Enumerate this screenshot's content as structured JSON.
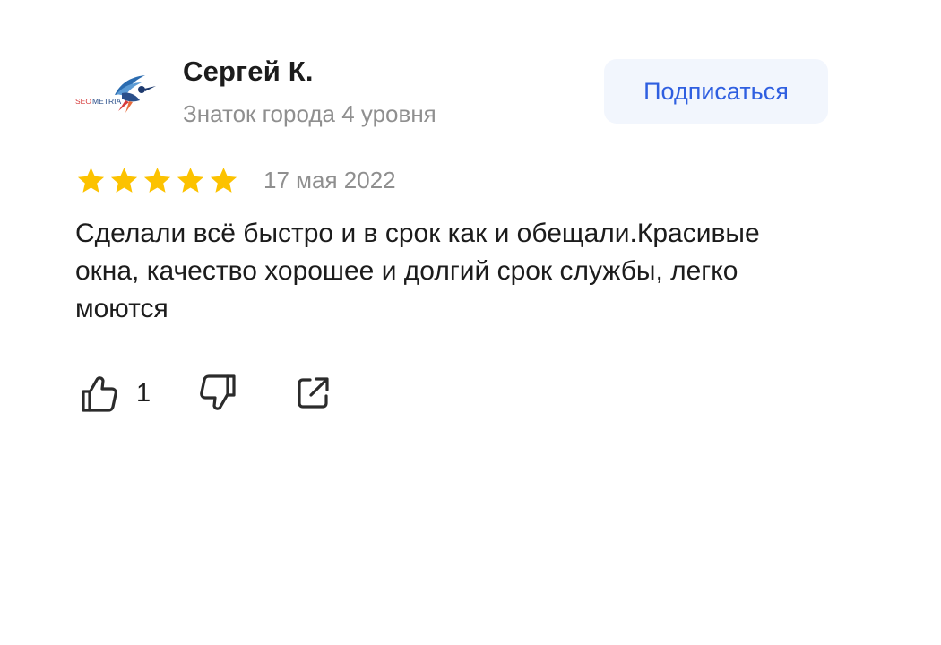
{
  "author": {
    "name": "Сергей К.",
    "level": "Знаток города 4 уровня",
    "avatar": {
      "logo_text": "SEOMETRIA",
      "icon": "hummingbird-logo-icon"
    }
  },
  "subscribe": {
    "label": "Подписаться"
  },
  "rating": {
    "value": 5,
    "max": 5,
    "star_color": "#fcc200"
  },
  "date": "17 мая 2022",
  "text": "Сделали всё быстро и в срок как и обещали.Красивые окна, качество хорошее и долгий срок службы, легко моются",
  "actions": {
    "like_count": "1",
    "like_icon": "thumbs-up-icon",
    "dislike_icon": "thumbs-down-icon",
    "share_icon": "share-icon"
  },
  "colors": {
    "accent": "#2f5fe0",
    "button_bg": "#f2f6fd",
    "muted_text": "#8f8f8f",
    "text": "#1c1c1c"
  }
}
